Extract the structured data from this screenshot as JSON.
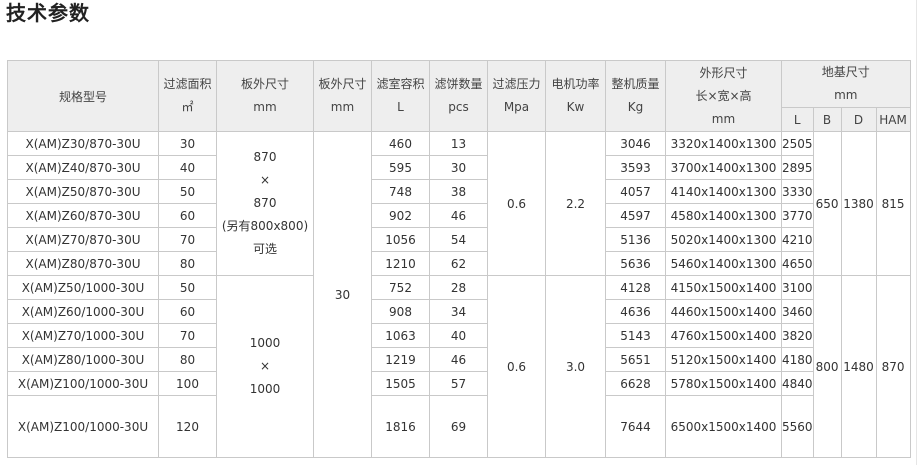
{
  "title": "技术参数",
  "headers": {
    "model": "规格型号",
    "area": [
      "过滤面积",
      "㎡"
    ],
    "plate_size": [
      "板外尺寸",
      "mm"
    ],
    "plate_thick": [
      "板外尺寸",
      "mm"
    ],
    "chamber": [
      "滤室容积",
      "L"
    ],
    "cakes": [
      "滤饼数量",
      "pcs"
    ],
    "pressure": [
      "过滤压力",
      "Mpa"
    ],
    "power": [
      "电机功率",
      "Kw"
    ],
    "weight": [
      "整机质量",
      "Kg"
    ],
    "outline": [
      "外形尺寸",
      "长×宽×高",
      "mm"
    ],
    "foundation": [
      "地基尺寸",
      "mm"
    ],
    "found_cols": [
      "L",
      "B",
      "D",
      "HAM"
    ]
  },
  "group1": {
    "plate_size": [
      "870",
      "×",
      "870",
      "(另有800x800)",
      "可选"
    ],
    "pressure": "0.6",
    "power": "2.2",
    "B": "650",
    "D": "1380",
    "HAM": "815"
  },
  "group2": {
    "plate_size": [
      "1000",
      "×",
      "1000"
    ],
    "pressure": "0.6",
    "power": "3.0",
    "B": "800",
    "D": "1480",
    "HAM": "870"
  },
  "plate_thick": "30",
  "rows": [
    {
      "model": "X(AM)Z30/870-30U",
      "area": "30",
      "chamber": "460",
      "cakes": "13",
      "weight": "3046",
      "outline": "3320x1400x1300",
      "L": "2505"
    },
    {
      "model": "X(AM)Z40/870-30U",
      "area": "40",
      "chamber": "595",
      "cakes": "30",
      "weight": "3593",
      "outline": "3700x1400x1300",
      "L": "2895"
    },
    {
      "model": "X(AM)Z50/870-30U",
      "area": "50",
      "chamber": "748",
      "cakes": "38",
      "weight": "4057",
      "outline": "4140x1400x1300",
      "L": "3330"
    },
    {
      "model": "X(AM)Z60/870-30U",
      "area": "60",
      "chamber": "902",
      "cakes": "46",
      "weight": "4597",
      "outline": "4580x1400x1300",
      "L": "3770"
    },
    {
      "model": "X(AM)Z70/870-30U",
      "area": "70",
      "chamber": "1056",
      "cakes": "54",
      "weight": "5136",
      "outline": "5020x1400x1300",
      "L": "4210"
    },
    {
      "model": "X(AM)Z80/870-30U",
      "area": "80",
      "chamber": "1210",
      "cakes": "62",
      "weight": "5636",
      "outline": "5460x1400x1300",
      "L": "4650"
    },
    {
      "model": "X(AM)Z50/1000-30U",
      "area": "50",
      "chamber": "752",
      "cakes": "28",
      "weight": "4128",
      "outline": "4150x1500x1400",
      "L": "3100"
    },
    {
      "model": "X(AM)Z60/1000-30U",
      "area": "60",
      "chamber": "908",
      "cakes": "34",
      "weight": "4636",
      "outline": "4460x1500x1400",
      "L": "3460"
    },
    {
      "model": "X(AM)Z70/1000-30U",
      "area": "70",
      "chamber": "1063",
      "cakes": "40",
      "weight": "5143",
      "outline": "4760x1500x1400",
      "L": "3820"
    },
    {
      "model": "X(AM)Z80/1000-30U",
      "area": "80",
      "chamber": "1219",
      "cakes": "46",
      "weight": "5651",
      "outline": "5120x1500x1400",
      "L": "4180"
    },
    {
      "model": "X(AM)Z100/1000-30U",
      "area": "100",
      "chamber": "1505",
      "cakes": "57",
      "weight": "6628",
      "outline": "5780x1500x1400",
      "L": "4840"
    },
    {
      "model": "X(AM)Z100/1000-30U",
      "area": "120",
      "chamber": "1816",
      "cakes": "69",
      "weight": "7644",
      "outline": "6500x1500x1400",
      "L": "5560"
    }
  ]
}
